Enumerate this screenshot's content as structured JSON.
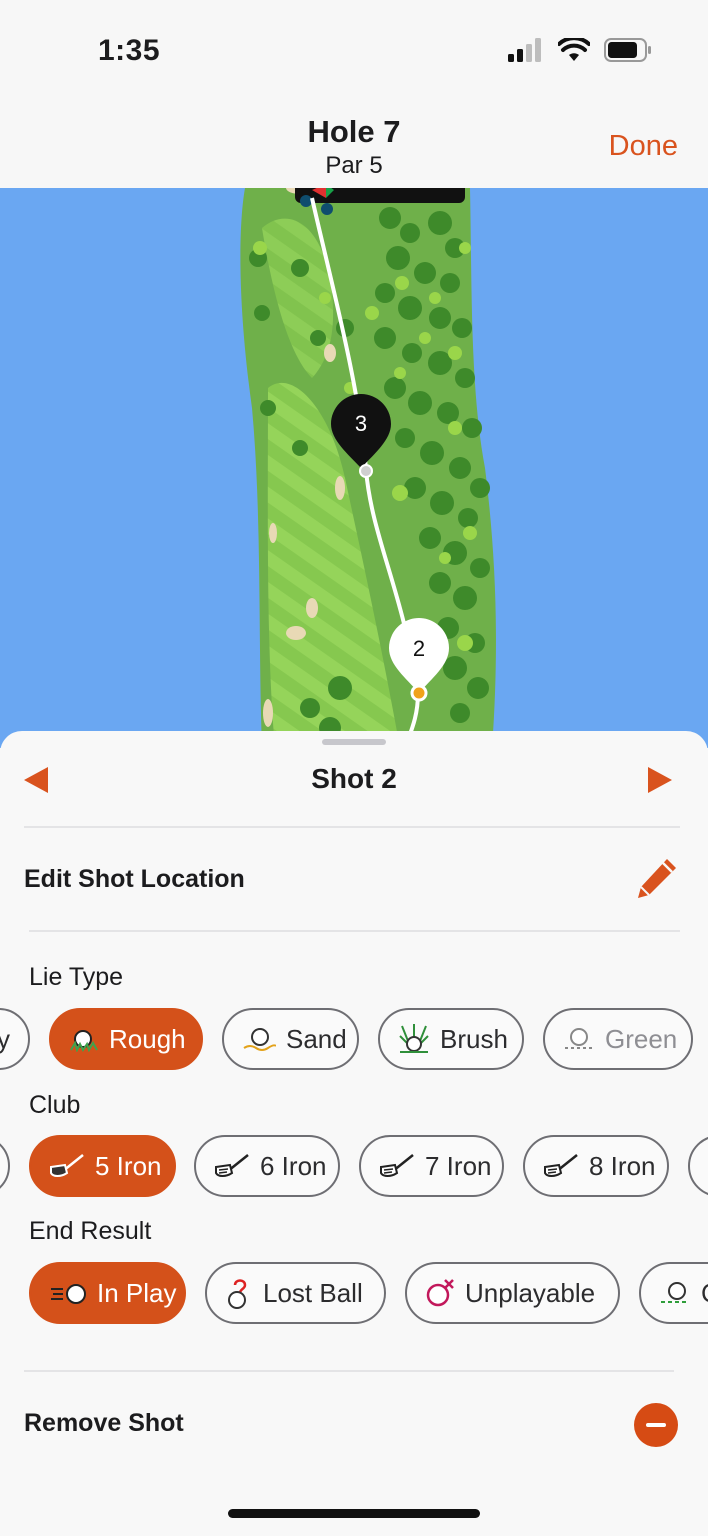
{
  "status_bar": {
    "time": "1:35"
  },
  "nav": {
    "title": "Hole 7",
    "subtitle": "Par 5",
    "done_label": "Done"
  },
  "map": {
    "markers": [
      {
        "label": "3"
      },
      {
        "label": "2"
      }
    ]
  },
  "sheet": {
    "shot_title": "Shot 2",
    "edit_location_label": "Edit Shot Location",
    "lie_type": {
      "label": "Lie Type",
      "options": [
        {
          "label": "y",
          "selected": false
        },
        {
          "label": "Rough",
          "selected": true
        },
        {
          "label": "Sand",
          "selected": false
        },
        {
          "label": "Brush",
          "selected": false
        },
        {
          "label": "Green",
          "selected": false
        }
      ]
    },
    "club": {
      "label": "Club",
      "options": [
        {
          "label": "5 Iron",
          "selected": true
        },
        {
          "label": "6 Iron",
          "selected": false
        },
        {
          "label": "7 Iron",
          "selected": false
        },
        {
          "label": "8 Iron",
          "selected": false
        }
      ]
    },
    "end_result": {
      "label": "End Result",
      "options": [
        {
          "label": "In Play",
          "selected": true
        },
        {
          "label": "Lost Ball",
          "selected": false
        },
        {
          "label": "Unplayable",
          "selected": false
        },
        {
          "label": "C",
          "selected": false
        }
      ]
    },
    "remove_label": "Remove Shot"
  },
  "colors": {
    "accent": "#d4511a",
    "water": "#6aa7f2",
    "fairway": "#7fc24a"
  }
}
